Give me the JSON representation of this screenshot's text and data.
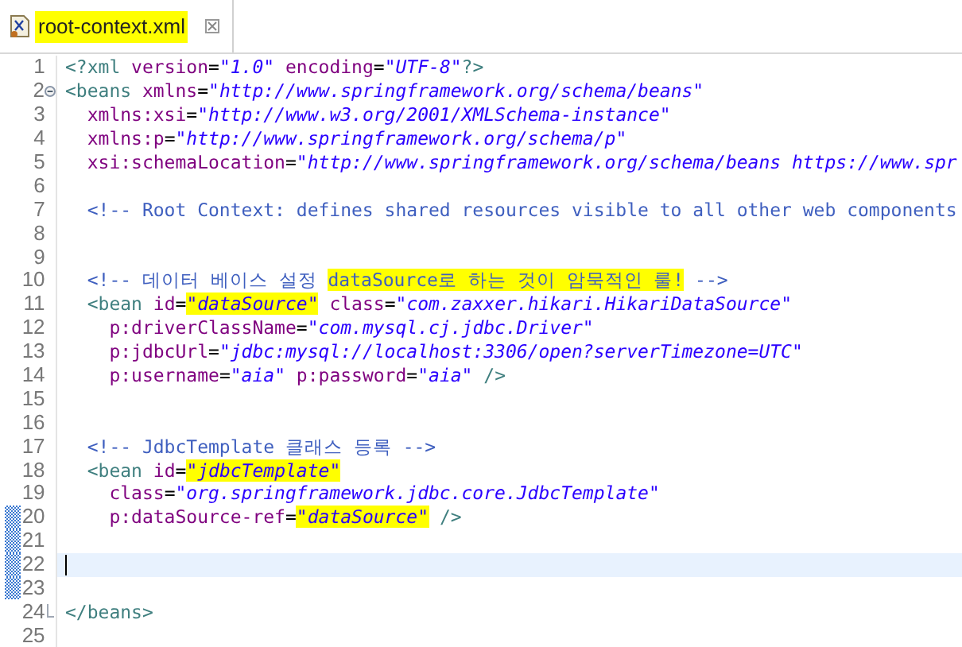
{
  "tab": {
    "title": "root-context.xml",
    "selected": true,
    "highlighted": true
  },
  "lines": [
    {
      "number": "1",
      "tokens": [
        {
          "kind": "tag",
          "t": "<?xml"
        },
        {
          "kind": "attr",
          "t": " version"
        },
        {
          "kind": "eq",
          "t": "="
        },
        {
          "kind": "val",
          "t": "\"1.0\""
        },
        {
          "kind": "attr",
          "t": " encoding"
        },
        {
          "kind": "eq",
          "t": "="
        },
        {
          "kind": "val",
          "t": "\"UTF-8\""
        },
        {
          "kind": "tag",
          "t": "?>"
        }
      ]
    },
    {
      "number": "2",
      "fold_start": true,
      "tokens": [
        {
          "kind": "tag",
          "t": "<beans"
        },
        {
          "kind": "attr",
          "t": " xmlns"
        },
        {
          "kind": "eq",
          "t": "="
        },
        {
          "kind": "val",
          "t": "\"http://www.springframework.org/schema/beans\""
        }
      ]
    },
    {
      "number": "3",
      "tokens": [
        {
          "kind": "attr",
          "t": "  xmlns:xsi"
        },
        {
          "kind": "eq",
          "t": "="
        },
        {
          "kind": "val",
          "t": "\"http://www.w3.org/2001/XMLSchema-instance\""
        }
      ]
    },
    {
      "number": "4",
      "tokens": [
        {
          "kind": "attr",
          "t": "  xmlns:p"
        },
        {
          "kind": "eq",
          "t": "="
        },
        {
          "kind": "val",
          "t": "\"http://www.springframework.org/schema/p\""
        }
      ]
    },
    {
      "number": "5",
      "tokens": [
        {
          "kind": "attr",
          "t": "  xsi:schemaLocation"
        },
        {
          "kind": "eq",
          "t": "="
        },
        {
          "kind": "val",
          "t": "\"http://www.springframework.org/schema/beans https://www.spr"
        }
      ]
    },
    {
      "number": "6"
    },
    {
      "number": "7",
      "tokens": [
        {
          "kind": "com",
          "t": "  <!-- Root Context: defines shared resources visible to all other web components"
        }
      ]
    },
    {
      "number": "8"
    },
    {
      "number": "9"
    },
    {
      "number": "10",
      "tokens": [
        {
          "kind": "com",
          "t": "  <!-- 데이터 베이스 설정 "
        },
        {
          "kind": "com",
          "t": "dataSource로 하는 것이 암묵적인 룰!",
          "hl": true
        },
        {
          "kind": "com",
          "t": " -->"
        }
      ]
    },
    {
      "number": "11",
      "tokens": [
        {
          "kind": "tag",
          "t": "  <bean"
        },
        {
          "kind": "attr",
          "t": " id"
        },
        {
          "kind": "eq",
          "t": "="
        },
        {
          "kind": "val",
          "t": "\"dataSource\"",
          "hl": true
        },
        {
          "kind": "attr",
          "t": " class"
        },
        {
          "kind": "eq",
          "t": "="
        },
        {
          "kind": "val",
          "t": "\"com.zaxxer.hikari.HikariDataSource\""
        }
      ]
    },
    {
      "number": "12",
      "tokens": [
        {
          "kind": "attr",
          "t": "    p:driverClassName"
        },
        {
          "kind": "eq",
          "t": "="
        },
        {
          "kind": "val",
          "t": "\"com.mysql.cj.jdbc.Driver\""
        }
      ]
    },
    {
      "number": "13",
      "tokens": [
        {
          "kind": "attr",
          "t": "    p:jdbcUrl"
        },
        {
          "kind": "eq",
          "t": "="
        },
        {
          "kind": "val",
          "t": "\"jdbc:mysql://localhost:3306/open?serverTimezone=UTC\""
        }
      ]
    },
    {
      "number": "14",
      "tokens": [
        {
          "kind": "attr",
          "t": "    p:username"
        },
        {
          "kind": "eq",
          "t": "="
        },
        {
          "kind": "val",
          "t": "\"aia\""
        },
        {
          "kind": "attr",
          "t": " p:password"
        },
        {
          "kind": "eq",
          "t": "="
        },
        {
          "kind": "val",
          "t": "\"aia\""
        },
        {
          "kind": "tag",
          "t": " />"
        }
      ]
    },
    {
      "number": "15"
    },
    {
      "number": "16"
    },
    {
      "number": "17",
      "tokens": [
        {
          "kind": "com",
          "t": "  <!-- JdbcTemplate 클래스 등록 -->"
        }
      ]
    },
    {
      "number": "18",
      "tokens": [
        {
          "kind": "tag",
          "t": "  <bean"
        },
        {
          "kind": "attr",
          "t": " id"
        },
        {
          "kind": "eq",
          "t": "="
        },
        {
          "kind": "val",
          "t": "\"jdbcTemplate\"",
          "hl": true
        }
      ]
    },
    {
      "number": "19",
      "tokens": [
        {
          "kind": "attr",
          "t": "    class"
        },
        {
          "kind": "eq",
          "t": "="
        },
        {
          "kind": "val",
          "t": "\"org.springframework.jdbc.core.JdbcTemplate\""
        }
      ]
    },
    {
      "number": "20",
      "changed": true,
      "tokens": [
        {
          "kind": "attr",
          "t": "    p:dataSource-ref"
        },
        {
          "kind": "eq",
          "t": "="
        },
        {
          "kind": "val",
          "t": "\"dataSource\"",
          "hl": true
        },
        {
          "kind": "tag",
          "t": " />"
        }
      ]
    },
    {
      "number": "21",
      "changed": true
    },
    {
      "number": "22",
      "changed": true,
      "current": true
    },
    {
      "number": "23",
      "changed": true
    },
    {
      "number": "24",
      "fold_end": true,
      "tokens": [
        {
          "kind": "tag",
          "t": "</beans>"
        }
      ]
    },
    {
      "number": "25"
    }
  ]
}
